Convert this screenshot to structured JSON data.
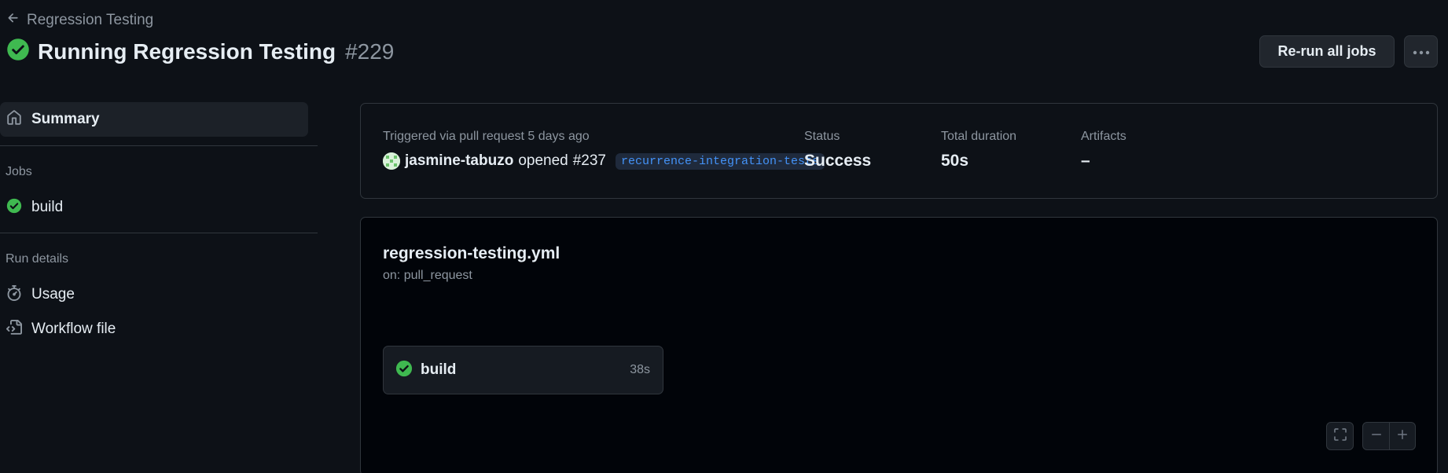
{
  "header": {
    "back_label": "Regression Testing",
    "title": "Running Regression Testing",
    "run_number": "#229",
    "rerun_label": "Re-run all jobs",
    "more_icon": "kebab-horizontal-icon"
  },
  "sidebar": {
    "summary_label": "Summary",
    "jobs_heading": "Jobs",
    "jobs": [
      {
        "label": "build",
        "status": "success"
      }
    ],
    "run_details_heading": "Run details",
    "run_details": [
      {
        "label": "Usage",
        "icon": "stopwatch-icon"
      },
      {
        "label": "Workflow file",
        "icon": "file-code-icon"
      }
    ]
  },
  "summary": {
    "trigger_text": "Triggered via pull request 5 days ago",
    "actor": "jasmine-tabuzo",
    "action": "opened",
    "pr": "#237",
    "branch": "recurrence-integration-tests",
    "status_label": "Status",
    "status_value": "Success",
    "duration_label": "Total duration",
    "duration_value": "50s",
    "artifacts_label": "Artifacts",
    "artifacts_value": "–"
  },
  "workflow": {
    "file": "regression-testing.yml",
    "trigger": "on: pull_request",
    "jobs": [
      {
        "name": "build",
        "duration": "38s",
        "status": "success"
      }
    ]
  },
  "colors": {
    "success": "#3fb950",
    "background": "#0d1117",
    "border": "#30363d",
    "link": "#4493f8"
  }
}
